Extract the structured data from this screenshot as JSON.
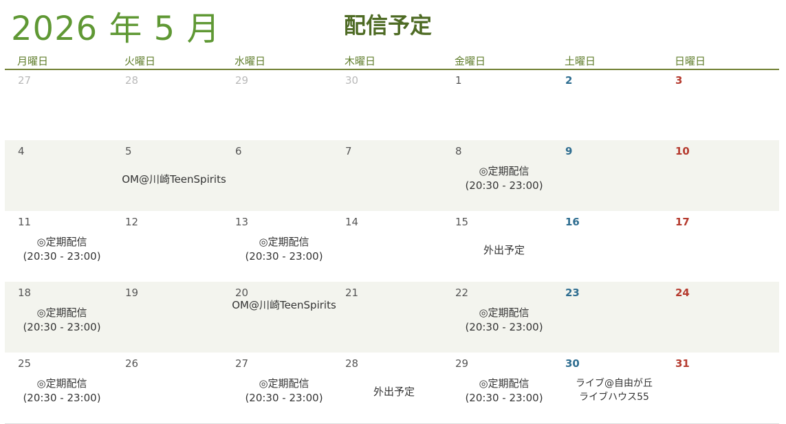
{
  "header": {
    "month_title": "2026 年 5 月",
    "page_title": "配信予定"
  },
  "weekdays": [
    "月曜日",
    "火曜日",
    "水曜日",
    "木曜日",
    "金曜日",
    "土曜日",
    "日曜日"
  ],
  "colors": {
    "title_green": "#5f9834",
    "heading_green": "#4e6b24",
    "saturday_blue": "#2e6d90",
    "sunday_red": "#b53a2e",
    "shaded_row": "#f3f4ee"
  },
  "weeks": [
    {
      "days": [
        {
          "num": "27",
          "other": true
        },
        {
          "num": "28",
          "other": true
        },
        {
          "num": "29",
          "other": true
        },
        {
          "num": "30",
          "other": true
        },
        {
          "num": "1"
        },
        {
          "num": "2"
        },
        {
          "num": "3"
        }
      ]
    },
    {
      "days": [
        {
          "num": "4"
        },
        {
          "num": "5",
          "event": [
            "OM@川崎TeenSpirits"
          ]
        },
        {
          "num": "6"
        },
        {
          "num": "7"
        },
        {
          "num": "8",
          "event": [
            "◎定期配信",
            "(20:30 - 23:00)"
          ]
        },
        {
          "num": "9"
        },
        {
          "num": "10"
        }
      ]
    },
    {
      "days": [
        {
          "num": "11",
          "event": [
            "◎定期配信",
            "(20:30 - 23:00)"
          ]
        },
        {
          "num": "12"
        },
        {
          "num": "13",
          "event": [
            "◎定期配信",
            "(20:30 - 23:00)"
          ]
        },
        {
          "num": "14"
        },
        {
          "num": "15",
          "event": [
            "外出予定"
          ]
        },
        {
          "num": "16"
        },
        {
          "num": "17"
        }
      ]
    },
    {
      "days": [
        {
          "num": "18",
          "event": [
            "◎定期配信",
            "(20:30 - 23:00)"
          ]
        },
        {
          "num": "19"
        },
        {
          "num": "20",
          "event": [
            "OM@川崎TeenSpirits"
          ],
          "event_top": true
        },
        {
          "num": "21"
        },
        {
          "num": "22",
          "event": [
            "◎定期配信",
            "(20:30 - 23:00)"
          ]
        },
        {
          "num": "23"
        },
        {
          "num": "24"
        }
      ]
    },
    {
      "days": [
        {
          "num": "25",
          "event": [
            "◎定期配信",
            "(20:30 - 23:00)"
          ]
        },
        {
          "num": "26"
        },
        {
          "num": "27",
          "event": [
            "◎定期配信",
            "(20:30 - 23:00)"
          ]
        },
        {
          "num": "28",
          "event": [
            "外出予定"
          ]
        },
        {
          "num": "29",
          "event": [
            "◎定期配信",
            "(20:30 - 23:00)"
          ]
        },
        {
          "num": "30",
          "event": [
            "ライブ@自由が丘",
            "ライブハウス55"
          ]
        },
        {
          "num": "31"
        }
      ]
    }
  ]
}
